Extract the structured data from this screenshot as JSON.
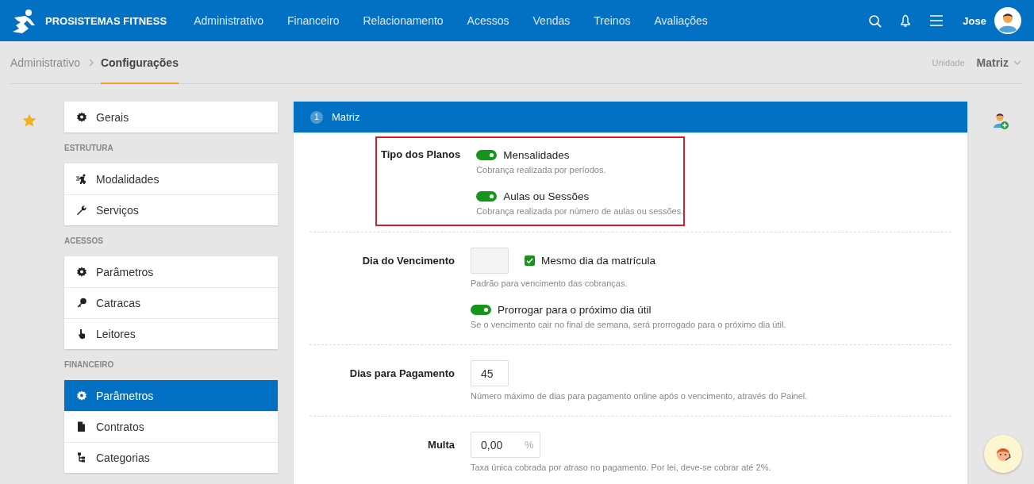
{
  "header": {
    "brand": "PROSISTEMAS FITNESS",
    "nav": [
      "Administrativo",
      "Financeiro",
      "Relacionamento",
      "Acessos",
      "Vendas",
      "Treinos",
      "Avaliações"
    ],
    "user": "Jose"
  },
  "breadcrumb": {
    "items": [
      "Administrativo",
      "Configurações"
    ],
    "unit_label": "Unidade",
    "unit": "Matriz"
  },
  "sidebar": {
    "groups": [
      {
        "items": [
          {
            "label": "Gerais",
            "selected": false
          }
        ]
      },
      {
        "heading": "ESTRUTURA",
        "items": [
          {
            "label": "Modalidades",
            "selected": false
          },
          {
            "label": "Serviços",
            "selected": false
          }
        ]
      },
      {
        "heading": "ACESSOS",
        "items": [
          {
            "label": "Parâmetros",
            "selected": false
          },
          {
            "label": "Catracas",
            "selected": false
          },
          {
            "label": "Leitores",
            "selected": false
          }
        ]
      },
      {
        "heading": "FINANCEIRO",
        "items": [
          {
            "label": "Parâmetros",
            "selected": true
          },
          {
            "label": "Contratos",
            "selected": false
          },
          {
            "label": "Categorias",
            "selected": false
          }
        ]
      }
    ]
  },
  "panel": {
    "number": "1",
    "title": "Matriz",
    "sections": [
      {
        "label": "Tipo dos Planos",
        "highlighted": true,
        "controls": [
          {
            "kind": "toggle",
            "label": "Mensalidades",
            "on": true,
            "hint": "Cobrança realizada por períodos."
          },
          {
            "kind": "toggle",
            "label": "Aulas ou Sessões",
            "on": true,
            "hint": "Cobrança realizada por número de aulas ou sessões."
          }
        ]
      },
      {
        "label": "Dia do Vencimento",
        "highlighted": false,
        "controls": [
          {
            "kind": "field_checkbox",
            "checkbox_label": "Mesmo dia da matrícula",
            "checked": true,
            "hint": "Padrão para vencimento das cobranças."
          },
          {
            "kind": "toggle",
            "label": "Prorrogar para o próximo dia útil",
            "on": true,
            "hint": "Se o vencimento cair no final de semana, será prorrogado para o próximo dia útil."
          }
        ]
      },
      {
        "label": "Dias para Pagamento",
        "highlighted": false,
        "controls": [
          {
            "kind": "field",
            "value": "45",
            "hint": "Número máximo de dias para pagamento online após o vencimento, através do Painel."
          }
        ]
      },
      {
        "label": "Multa",
        "highlighted": false,
        "controls": [
          {
            "kind": "field",
            "value": "0,00",
            "suffix": "%",
            "hint": "Taxa única cobrada por atraso no pagamento. Por lei, deve-se cobrar até 2%."
          }
        ]
      }
    ]
  }
}
